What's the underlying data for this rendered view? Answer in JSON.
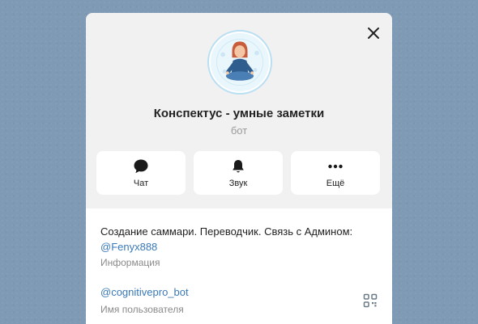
{
  "profile": {
    "title": "Конспектус - умные заметки",
    "subtitle": "бот"
  },
  "actions": [
    {
      "label": "Чат",
      "icon": "chat-bubble-icon"
    },
    {
      "label": "Звук",
      "icon": "bell-icon"
    },
    {
      "label": "Ещё",
      "icon": "more-dots-icon"
    }
  ],
  "info": {
    "description": "Создание саммари. Переводчик. Связь с Админом:",
    "description_link": "@Fenyx888",
    "description_caption": "Информация",
    "username": "@cognitivepro_bot",
    "username_caption": "Имя пользователя"
  },
  "colors": {
    "background": "#7f9ab5",
    "panel": "#f1f1f1",
    "link": "#3a79b8",
    "avatar_ring": "#b9dff3"
  }
}
